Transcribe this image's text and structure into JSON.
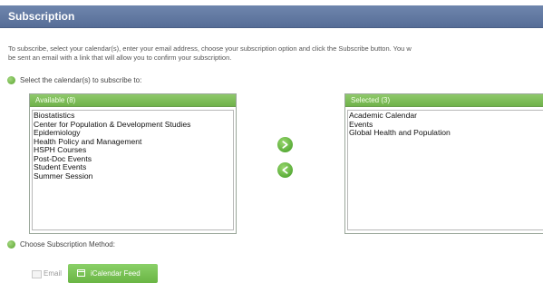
{
  "header": {
    "title": "Subscription"
  },
  "intro": {
    "line1": "To subscribe, select your calendar(s), enter your email address, choose your subscription option and click the Subscribe button. You w",
    "line2": "be sent an email with a link that will allow you to confirm your subscription."
  },
  "steps": {
    "select_label": "Select the calendar(s) to subscribe to:",
    "method_label": "Choose Subscription Method:"
  },
  "available": {
    "header": "Available (8)",
    "items": [
      "Biostatistics",
      "Center for Population & Development Studies",
      "Epidemiology",
      "Health Policy and Management",
      "HSPH Courses",
      "Post-Doc Events",
      "Student Events",
      "Summer Session"
    ]
  },
  "selected": {
    "header": "Selected (3)",
    "items": [
      "Academic Calendar",
      "Events",
      "Global Health and Population"
    ]
  },
  "options": {
    "email_label": "Email",
    "ical_label": "iCalendar Feed",
    "active": "iCalendar Feed"
  },
  "icons": {
    "add": "arrow-right-icon",
    "remove": "arrow-left-icon",
    "step_bullet": "green-dot-icon",
    "calendar": "calendar-icon"
  },
  "colors": {
    "header_bg": "#566d97",
    "accent_green": "#6fb24a",
    "header_text": "#ffffff"
  }
}
